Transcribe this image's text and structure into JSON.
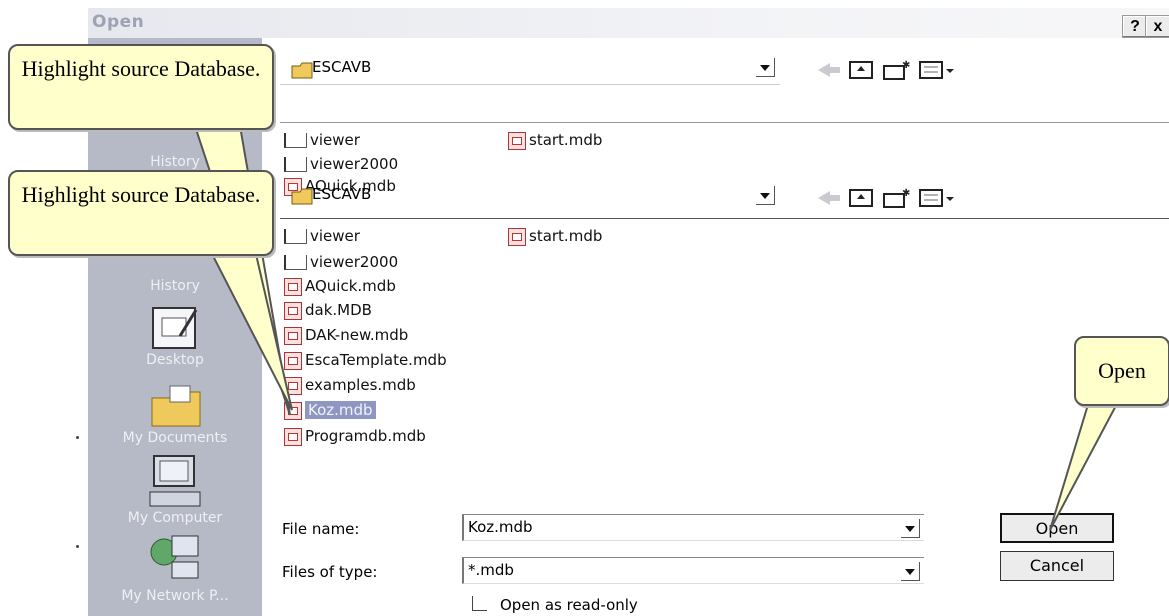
{
  "dialog": {
    "title": "Open",
    "help_btn": "?",
    "close_btn": "x"
  },
  "places": [
    {
      "label": "History",
      "icon": "history-icon"
    },
    {
      "label": "History",
      "icon": "history-icon"
    },
    {
      "label": "Desktop",
      "icon": "desktop-icon"
    },
    {
      "label": "My Documents",
      "icon": "my-documents-icon"
    },
    {
      "label": "My Computer",
      "icon": "my-computer-icon"
    },
    {
      "label": "My Network P...",
      "icon": "network-places-icon"
    }
  ],
  "lookin": {
    "folder": "ESCAVB"
  },
  "files_top": [
    {
      "name": "viewer",
      "type": "folder"
    },
    {
      "name": "viewer2000",
      "type": "folder"
    },
    {
      "name": "AQuick.mdb",
      "type": "mdb"
    },
    {
      "name": "start.mdb",
      "type": "mdb"
    }
  ],
  "files": [
    {
      "name": "viewer",
      "type": "folder"
    },
    {
      "name": "viewer2000",
      "type": "folder"
    },
    {
      "name": "AQuick.mdb",
      "type": "mdb"
    },
    {
      "name": "dak.MDB",
      "type": "mdb"
    },
    {
      "name": "DAK-new.mdb",
      "type": "mdb"
    },
    {
      "name": "EscaTemplate.mdb",
      "type": "mdb"
    },
    {
      "name": "examples.mdb",
      "type": "mdb"
    },
    {
      "name": "Koz.mdb",
      "type": "mdb",
      "selected": true
    },
    {
      "name": "Programdb.mdb",
      "type": "mdb"
    },
    {
      "name": "start.mdb",
      "type": "mdb"
    }
  ],
  "form": {
    "file_name_label": "File name:",
    "file_name_value": "Koz.mdb",
    "file_type_label": "Files of type:",
    "file_type_value": "*.mdb",
    "readonly_label": "Open as read-only",
    "open_button": "Open",
    "cancel_button": "Cancel"
  },
  "callouts": {
    "source_1": "Highlight source Database.",
    "source_2": "Highlight source Database.",
    "open": "Open"
  },
  "colors": {
    "callout_fill": "#ffffcc",
    "selection": "#8e97c3",
    "places_bar": "#b6b9c6"
  }
}
